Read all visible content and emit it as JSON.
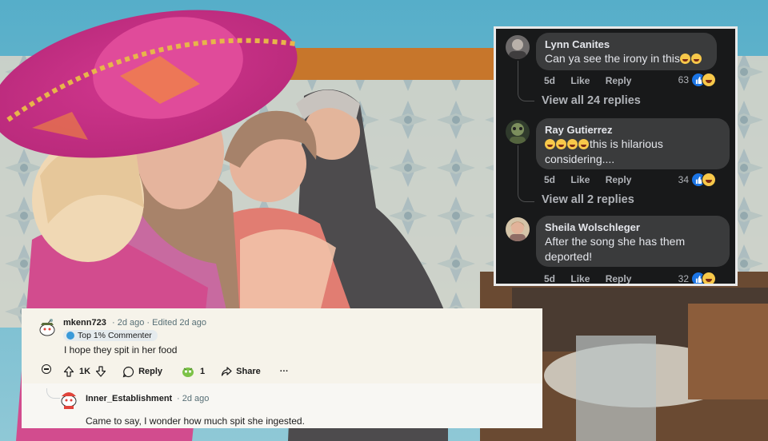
{
  "facebook": {
    "comments": [
      {
        "author": "Lynn Canites",
        "text": "Can ya see the irony in this",
        "emoji_count": 2,
        "time": "5d",
        "like_label": "Like",
        "reply_label": "Reply",
        "reactions": "63",
        "view_replies": "View all 24 replies"
      },
      {
        "author": "Ray Gutierrez",
        "text_line1": "this is hilarious",
        "text_line2": "considering....",
        "emoji_count": 4,
        "time": "5d",
        "like_label": "Like",
        "reply_label": "Reply",
        "reactions": "34",
        "view_replies": "View all 2 replies"
      },
      {
        "author": "Sheila Wolschleger",
        "text_line1": "After the song she has them",
        "text_line2": "deported!",
        "time": "5d",
        "like_label": "Like",
        "reply_label": "Reply",
        "reactions": "32"
      }
    ],
    "colors": {
      "panel": "#18191a",
      "bubble": "#3a3b3c",
      "like_blue": "#1b74e4"
    }
  },
  "reddit": {
    "comment": {
      "username": "mkenn723",
      "meta": "· 2d ago · Edited 2d ago",
      "flair": "Top 1% Commenter",
      "body": "I hope they spit in her food",
      "votes": "1K",
      "reply_label": "Reply",
      "award_count": "1",
      "share_label": "Share",
      "more_label": "···"
    },
    "reply": {
      "username": "Inner_Establishment",
      "meta": "· 2d ago",
      "body": "Came to say, I wonder how much spit she ingested."
    }
  },
  "icons": [
    "upvote-icon",
    "downvote-icon",
    "reply-bubble-icon",
    "award-icon",
    "share-icon",
    "like-thumb-icon",
    "haha-emoji-icon"
  ]
}
